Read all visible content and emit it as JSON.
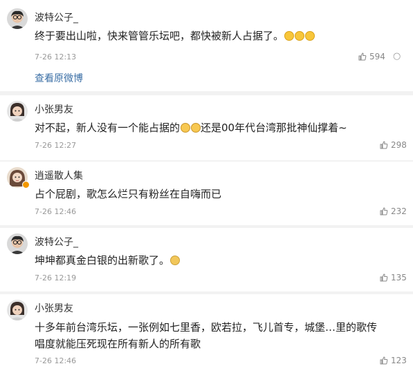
{
  "comments": [
    {
      "user": "波特公子_",
      "text": "终于要出山啦，快来管管乐坛吧，都快被新人占据了。",
      "time": "7-26 12:13",
      "likes": "594",
      "link": "查看原微博",
      "more": "○"
    },
    {
      "user": "小张男友",
      "text_a": "对不起，新人没有一个能占据的",
      "text_b": "还是00年代台湾那批神仙撑着~",
      "time": "7-26 12:27",
      "likes": "298"
    },
    {
      "user": "逍遥散人集",
      "text": "占个屁剧，歌怎么烂只有粉丝在自嗨而已",
      "time": "7-26 12:46",
      "likes": "232"
    },
    {
      "user": "波特公子_",
      "text": "坤坤都真金白银的出新歌了。",
      "time": "7-26 12:19",
      "likes": "135"
    },
    {
      "user": "小张男友",
      "text_line1": "十多年前台湾乐坛，一张例如七里香，欧若拉，飞儿首专，城堡…里的歌传",
      "text_line2": "唱度就能压死现在所有新人的所有歌",
      "time": "7-26 12:46",
      "likes": "123"
    }
  ]
}
